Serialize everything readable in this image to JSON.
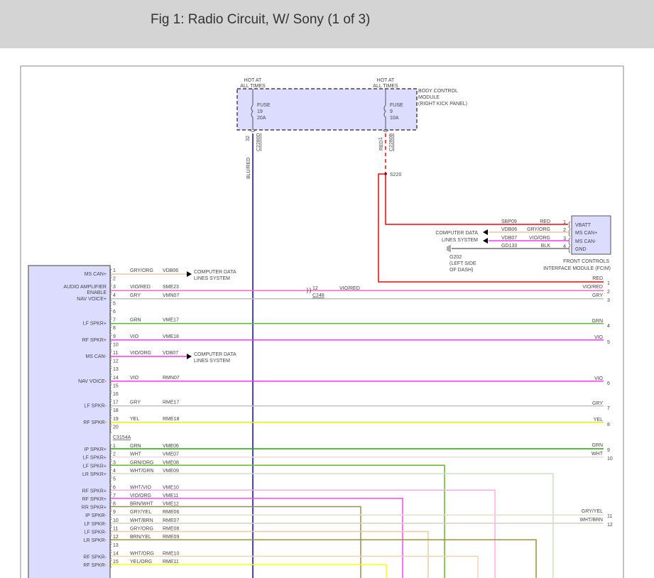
{
  "title": "Fig 1: Radio Circuit, W/ Sony (1 of 3)",
  "bcm": {
    "name": [
      "BODY CONTROL",
      "MODULE",
      "(RIGHT KICK PANEL)"
    ],
    "fill": "#dcdcff",
    "feeds": [
      {
        "hot": [
          "HOT AT",
          "ALL TIMES"
        ],
        "fuse": [
          "FUSE",
          "19",
          "20A"
        ],
        "pin": "32",
        "connector": "C2280D",
        "wire": "BLU/RED",
        "color": "#0000ff"
      },
      {
        "hot": [
          "HOT AT",
          "ALL TIMES"
        ],
        "fuse": [
          "FUSE",
          "9",
          "10A"
        ],
        "pin": "1",
        "connector": "C2280B",
        "wire": "RED",
        "color": "#ff0000"
      }
    ]
  },
  "splice": "S220",
  "computer_data_lines": [
    "COMPUTER DATA",
    "LINES SYSTEM"
  ],
  "fcim": {
    "name": [
      "FRONT CONTROLS",
      "INTERFACE MODULE (FCIM)"
    ],
    "fill": "#dcdcff",
    "pins": [
      {
        "num": "1",
        "label": "VBATT",
        "circuit": "SBP09",
        "wire": "RED",
        "color": "#ff0000"
      },
      {
        "num": "2",
        "label": "MS CAN+",
        "circuit": "VDB06",
        "wire": "GRY/ORG",
        "color": "#e8c8a8"
      },
      {
        "num": "3",
        "label": "MS CAN-",
        "circuit": "VDB07",
        "wire": "VIO/ORG",
        "color": "#ff33ff"
      },
      {
        "num": "4",
        "label": "GND",
        "circuit": "GD133",
        "wire": "BLK",
        "color": "#555555"
      }
    ]
  },
  "ground": {
    "id": "G202",
    "location": [
      "(LEFT SIDE",
      "OF DASH)"
    ]
  },
  "inline_connector": {
    "pin": "12",
    "wire": "VIO/RED",
    "name": "C248"
  },
  "radio": {
    "fill": "#dcdcff",
    "connector1": {
      "pins": [
        {
          "num": "1",
          "label": "MS CAN+",
          "wire": "GRY/ORG",
          "circuit": "VDB06",
          "color": "#e8c8a8"
        },
        {
          "num": "2"
        },
        {
          "num": "3",
          "label": "AUDIO AMPLIFIER",
          "label2": "ENABLE",
          "wire": "VIO/RED",
          "circuit": "SME23",
          "color": "#ff66cc"
        },
        {
          "num": "4",
          "label": "NAV VOICE+",
          "wire": "GRY",
          "circuit": "VMN07",
          "color": "#c0c0c0"
        },
        {
          "num": "5"
        },
        {
          "num": "6"
        },
        {
          "num": "7",
          "label": "LF SPKR+",
          "wire": "GRN",
          "circuit": "VME17",
          "color": "#55bb33"
        },
        {
          "num": "8"
        },
        {
          "num": "9",
          "label": "RF SPKR+",
          "wire": "VIO",
          "circuit": "VME18",
          "color": "#ff33ff"
        },
        {
          "num": "10"
        },
        {
          "num": "11",
          "label": "MS CAN-",
          "wire": "VIO/ORG",
          "circuit": "VDB07",
          "color": "#ff33ff"
        },
        {
          "num": "12"
        },
        {
          "num": "13"
        },
        {
          "num": "14",
          "label": "NAV VOICE-",
          "wire": "VIO",
          "circuit": "RMN07",
          "color": "#ff33ff"
        },
        {
          "num": "15"
        },
        {
          "num": "16"
        },
        {
          "num": "17",
          "label": "LF SPKR-",
          "wire": "GRY",
          "circuit": "RME17",
          "color": "#c0c0c0"
        },
        {
          "num": "18"
        },
        {
          "num": "19",
          "label": "RF SPKR-",
          "wire": "YEL",
          "circuit": "RME18",
          "color": "#eeee00"
        },
        {
          "num": "20"
        }
      ]
    },
    "connector2": {
      "name": "C3154A",
      "pins": [
        {
          "num": "1",
          "label": "IP SPKR+",
          "wire": "GRN",
          "circuit": "VME06",
          "color": "#22aa00"
        },
        {
          "num": "2",
          "label": "LF SPKR+",
          "wire": "WHT",
          "circuit": "VME07",
          "color": "#dddddd"
        },
        {
          "num": "3",
          "label": "LF SPKR+",
          "wire": "GRN/ORG",
          "circuit": "VME08",
          "color": "#66bb22"
        },
        {
          "num": "4",
          "label": "LR SPKR+",
          "wire": "WHT/GRN",
          "circuit": "VME09",
          "color": "#cce0c0"
        },
        {
          "num": "5"
        },
        {
          "num": "6",
          "label": "RF SPKR+",
          "wire": "WHT/VIO",
          "circuit": "VME10",
          "color": "#ffaaee"
        },
        {
          "num": "7",
          "label": "RF SPKR+",
          "wire": "VIO/ORG",
          "circuit": "VME11",
          "color": "#ff44ff"
        },
        {
          "num": "8",
          "label": "RR SPKR+",
          "wire": "BRN/WHT",
          "circuit": "VME12",
          "color": "#a08850"
        },
        {
          "num": "9",
          "label": "IP SPKR-",
          "wire": "GRY/YEL",
          "circuit": "RME06",
          "color": "#e0e0c8"
        },
        {
          "num": "10",
          "label": "LF SPKR-",
          "wire": "WHT/BRN",
          "circuit": "RME07",
          "color": "#d8d0c0"
        },
        {
          "num": "11",
          "label": "LF SPKR-",
          "wire": "GRY/ORG",
          "circuit": "RME08",
          "color": "#f0c8a0"
        },
        {
          "num": "12",
          "label": "LR SPKR-",
          "wire": "BRN/YEL",
          "circuit": "RME09",
          "color": "#a09030"
        },
        {
          "num": "13"
        },
        {
          "num": "14",
          "label": "RF SPKR-",
          "wire": "WHT/ORG",
          "circuit": "RME10",
          "color": "#f8d0b0"
        },
        {
          "num": "15",
          "label": "RF SPKR-",
          "wire": "YEL/ORG",
          "circuit": "RME11",
          "color": "#ffff00"
        }
      ]
    }
  },
  "continuations": [
    {
      "num": "1",
      "wire": "RED"
    },
    {
      "num": "2",
      "wire": "VIO/RED"
    },
    {
      "num": "3",
      "wire": "GRY"
    },
    {
      "num": "4",
      "wire": "GRN"
    },
    {
      "num": "5",
      "wire": "VIO"
    },
    {
      "num": "6",
      "wire": "VIO"
    },
    {
      "num": "7",
      "wire": "GRY"
    },
    {
      "num": "8",
      "wire": "YEL"
    },
    {
      "num": "9",
      "wire": "GRN"
    },
    {
      "num": "10",
      "wire": "WHT"
    },
    {
      "num": "11",
      "wire": "GRY/YEL"
    },
    {
      "num": "12",
      "wire": "WHT/BRN"
    }
  ]
}
